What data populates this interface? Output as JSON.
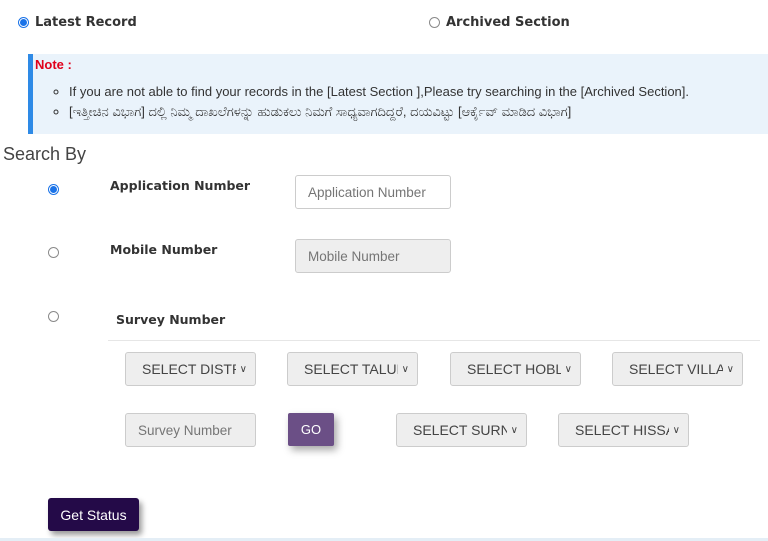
{
  "record_type": {
    "options": [
      {
        "label": "Latest Record",
        "selected": true
      },
      {
        "label": "Archived Section",
        "selected": false
      }
    ]
  },
  "note": {
    "title": "Note :",
    "items": [
      "If you are not able to find your records in the [Latest Section ],Please try searching in the [Archived Section].",
      "[ಇತ್ತೀಚಿನ ವಿಭಾಗ] ದಲ್ಲಿ ನಿಮ್ಮ ದಾಖಲೆಗಳನ್ನು ಹುಡುಕಲು ನಿಮಗೆ ಸಾಧ್ಯವಾಗದಿದ್ದರೆ, ದಯವಿಟ್ಟು [ಆರ್ಕೈವ್ ಮಾಡಿದ ವಿಭಾಗ]"
    ]
  },
  "search_by": {
    "heading": "Search By",
    "options": [
      {
        "label": "Application Number",
        "selected": true,
        "input_placeholder": "Application Number",
        "input_value": "",
        "input_disabled": false
      },
      {
        "label": "Mobile Number",
        "selected": false,
        "input_placeholder": "Mobile Number",
        "input_value": "",
        "input_disabled": true
      },
      {
        "label": "Survey Number",
        "selected": false
      }
    ]
  },
  "survey": {
    "selects_row1": [
      "SELECT DISTRICT",
      "SELECT TALUK",
      "SELECT HOBLI",
      "SELECT VILLAGE"
    ],
    "survey_input_placeholder": "Survey Number",
    "go_label": "GO",
    "selects_row2": [
      "SELECT SURNOC",
      "SELECT HISSA"
    ]
  },
  "get_status_label": "Get Status",
  "colors": {
    "radio_accent": "#1a73e8",
    "note_title": "#e0001b",
    "note_bg": "#eaf3fb",
    "note_border": "#2e8ae6",
    "go_button": "#6b4f86",
    "get_status_button": "#240a48"
  }
}
